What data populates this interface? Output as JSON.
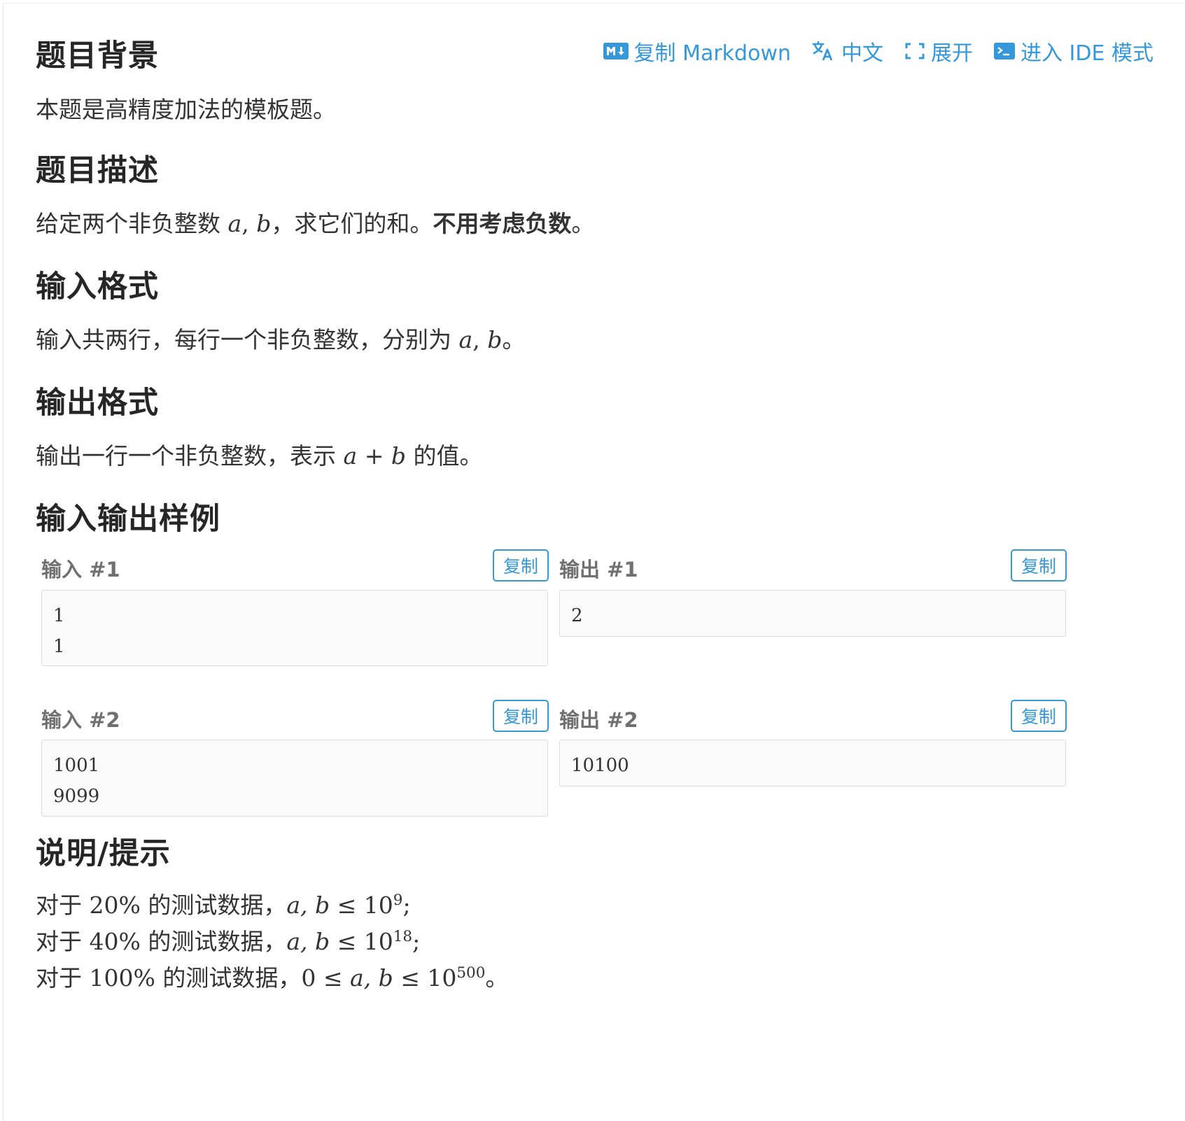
{
  "toolbar": {
    "copy_markdown": "复制 Markdown",
    "chinese": "中文",
    "expand": "展开",
    "ide_mode": "进入 IDE 模式",
    "accent_color": "#3498db"
  },
  "sections": {
    "background_title": "题目背景",
    "background_text": "本题是高精度加法的模板题。",
    "description_title": "题目描述",
    "description": {
      "t1": "给定两个非负整数",
      "a": "a",
      "comma": ",",
      "b": "b",
      "t2": "，求它们的和。",
      "bold": "不用考虑负数",
      "t3": "。"
    },
    "input_title": "输入格式",
    "input": {
      "t1": "输入共两行，每行一个非负整数，分别为",
      "a": "a",
      "comma": ",",
      "b": "b",
      "t2": "。"
    },
    "output_title": "输出格式",
    "output": {
      "t1": "输出一行一个非负整数，表示",
      "a": "a",
      "plus": "+",
      "b": "b",
      "t2": "的值。"
    },
    "samples_title": "输入输出样例",
    "hint_title": "说明/提示"
  },
  "samples": [
    {
      "input_label": "输入 #1",
      "output_label": "输出 #1",
      "copy": "复制",
      "input_lines": [
        "1",
        "1"
      ],
      "output_lines": [
        "2"
      ]
    },
    {
      "input_label": "输入 #2",
      "output_label": "输出 #2",
      "copy": "复制",
      "input_lines": [
        "1001",
        "9099"
      ],
      "output_lines": [
        "10100"
      ]
    }
  ],
  "hints": [
    {
      "pre": "对于",
      "pct": "20%",
      "mid": "的测试数据，",
      "lower": "",
      "vars": "a, b",
      "leq": "≤",
      "base": "10",
      "exp": "9",
      "end": ";"
    },
    {
      "pre": "对于",
      "pct": "40%",
      "mid": "的测试数据，",
      "lower": "",
      "vars": "a, b",
      "leq": "≤",
      "base": "10",
      "exp": "18",
      "end": ";"
    },
    {
      "pre": "对于",
      "pct": "100%",
      "mid": "的测试数据，",
      "lower": "0 ≤",
      "vars": "a, b",
      "leq": "≤",
      "base": "10",
      "exp": "500",
      "end": "。"
    }
  ]
}
